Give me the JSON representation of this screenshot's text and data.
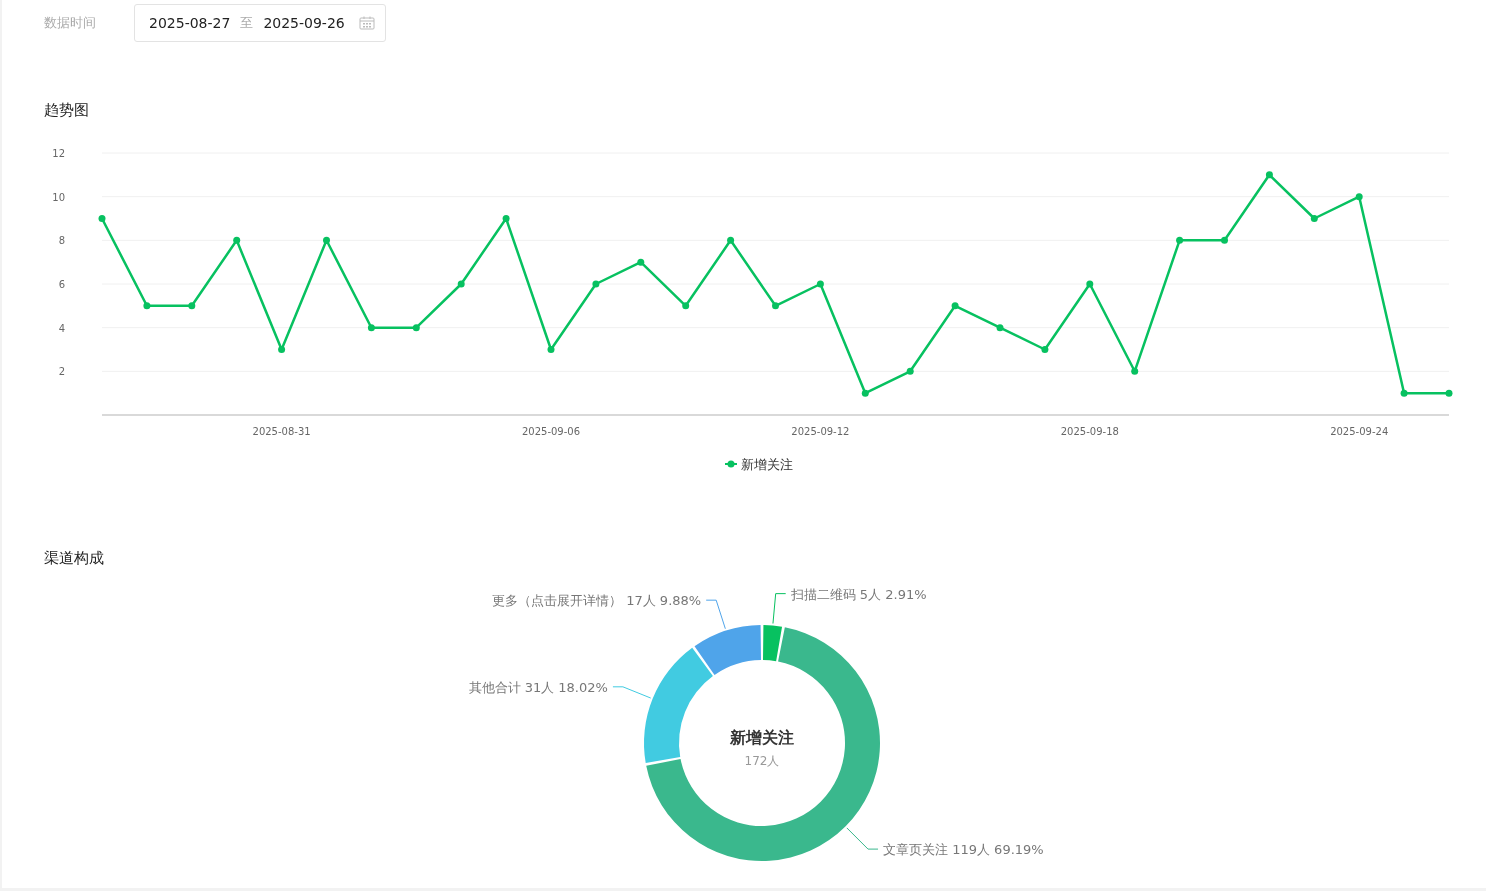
{
  "filter": {
    "label": "数据时间",
    "start": "2025-08-27",
    "separator": "至",
    "end": "2025-09-26"
  },
  "trend": {
    "title": "趋势图",
    "chart_data": {
      "type": "line",
      "x": [
        "2025-08-27",
        "2025-08-28",
        "2025-08-29",
        "2025-08-30",
        "2025-08-31",
        "2025-09-01",
        "2025-09-02",
        "2025-09-03",
        "2025-09-04",
        "2025-09-05",
        "2025-09-06",
        "2025-09-07",
        "2025-09-08",
        "2025-09-09",
        "2025-09-10",
        "2025-09-11",
        "2025-09-12",
        "2025-09-13",
        "2025-09-14",
        "2025-09-15",
        "2025-09-16",
        "2025-09-17",
        "2025-09-18",
        "2025-09-19",
        "2025-09-20",
        "2025-09-21",
        "2025-09-22",
        "2025-09-23",
        "2025-09-24",
        "2025-09-25",
        "2025-09-26"
      ],
      "grid": true,
      "series": [
        {
          "name": "新增关注",
          "color": "#07c160",
          "marker": "circle",
          "values": [
            9,
            5,
            5,
            8,
            3,
            8,
            4,
            4,
            6,
            9,
            3,
            6,
            7,
            5,
            8,
            5,
            6,
            1,
            2,
            5,
            4,
            3,
            6,
            2,
            8,
            8,
            11,
            9,
            10,
            1,
            1
          ]
        }
      ],
      "ylim": [
        0,
        12
      ],
      "yticks": [
        {
          "value": 2,
          "label": "2"
        },
        {
          "value": 4,
          "label": "4"
        },
        {
          "value": 6,
          "label": "6"
        },
        {
          "value": 8,
          "label": "8"
        },
        {
          "value": 10,
          "label": "10"
        },
        {
          "value": 12,
          "label": "12"
        }
      ],
      "xlim": [
        "2025-08-27",
        "2025-09-26"
      ],
      "xticks": [
        "2025-08-31",
        "2025-09-06",
        "2025-09-12",
        "2025-09-18",
        "2025-09-24"
      ]
    }
  },
  "channels": {
    "title": "渠道构成",
    "center_title": "新增关注",
    "center_value": "172人",
    "chart_data": {
      "type": "donut",
      "categories": [
        "扫描二维码",
        "更多（点击展开详情）",
        "其他合计",
        "文章页关注"
      ],
      "values": [
        2.91,
        9.88,
        18.02,
        69.19
      ]
    },
    "slices": [
      {
        "value_text": "5人 2.91%",
        "color": "#07c160"
      },
      {
        "value_text": "17人 9.88%",
        "color": "#4fa4ea"
      },
      {
        "value_text": "31人 18.02%",
        "color": "#41cbe1"
      },
      {
        "value_text": "119人 69.19%",
        "color": "#3ab88d"
      }
    ]
  }
}
